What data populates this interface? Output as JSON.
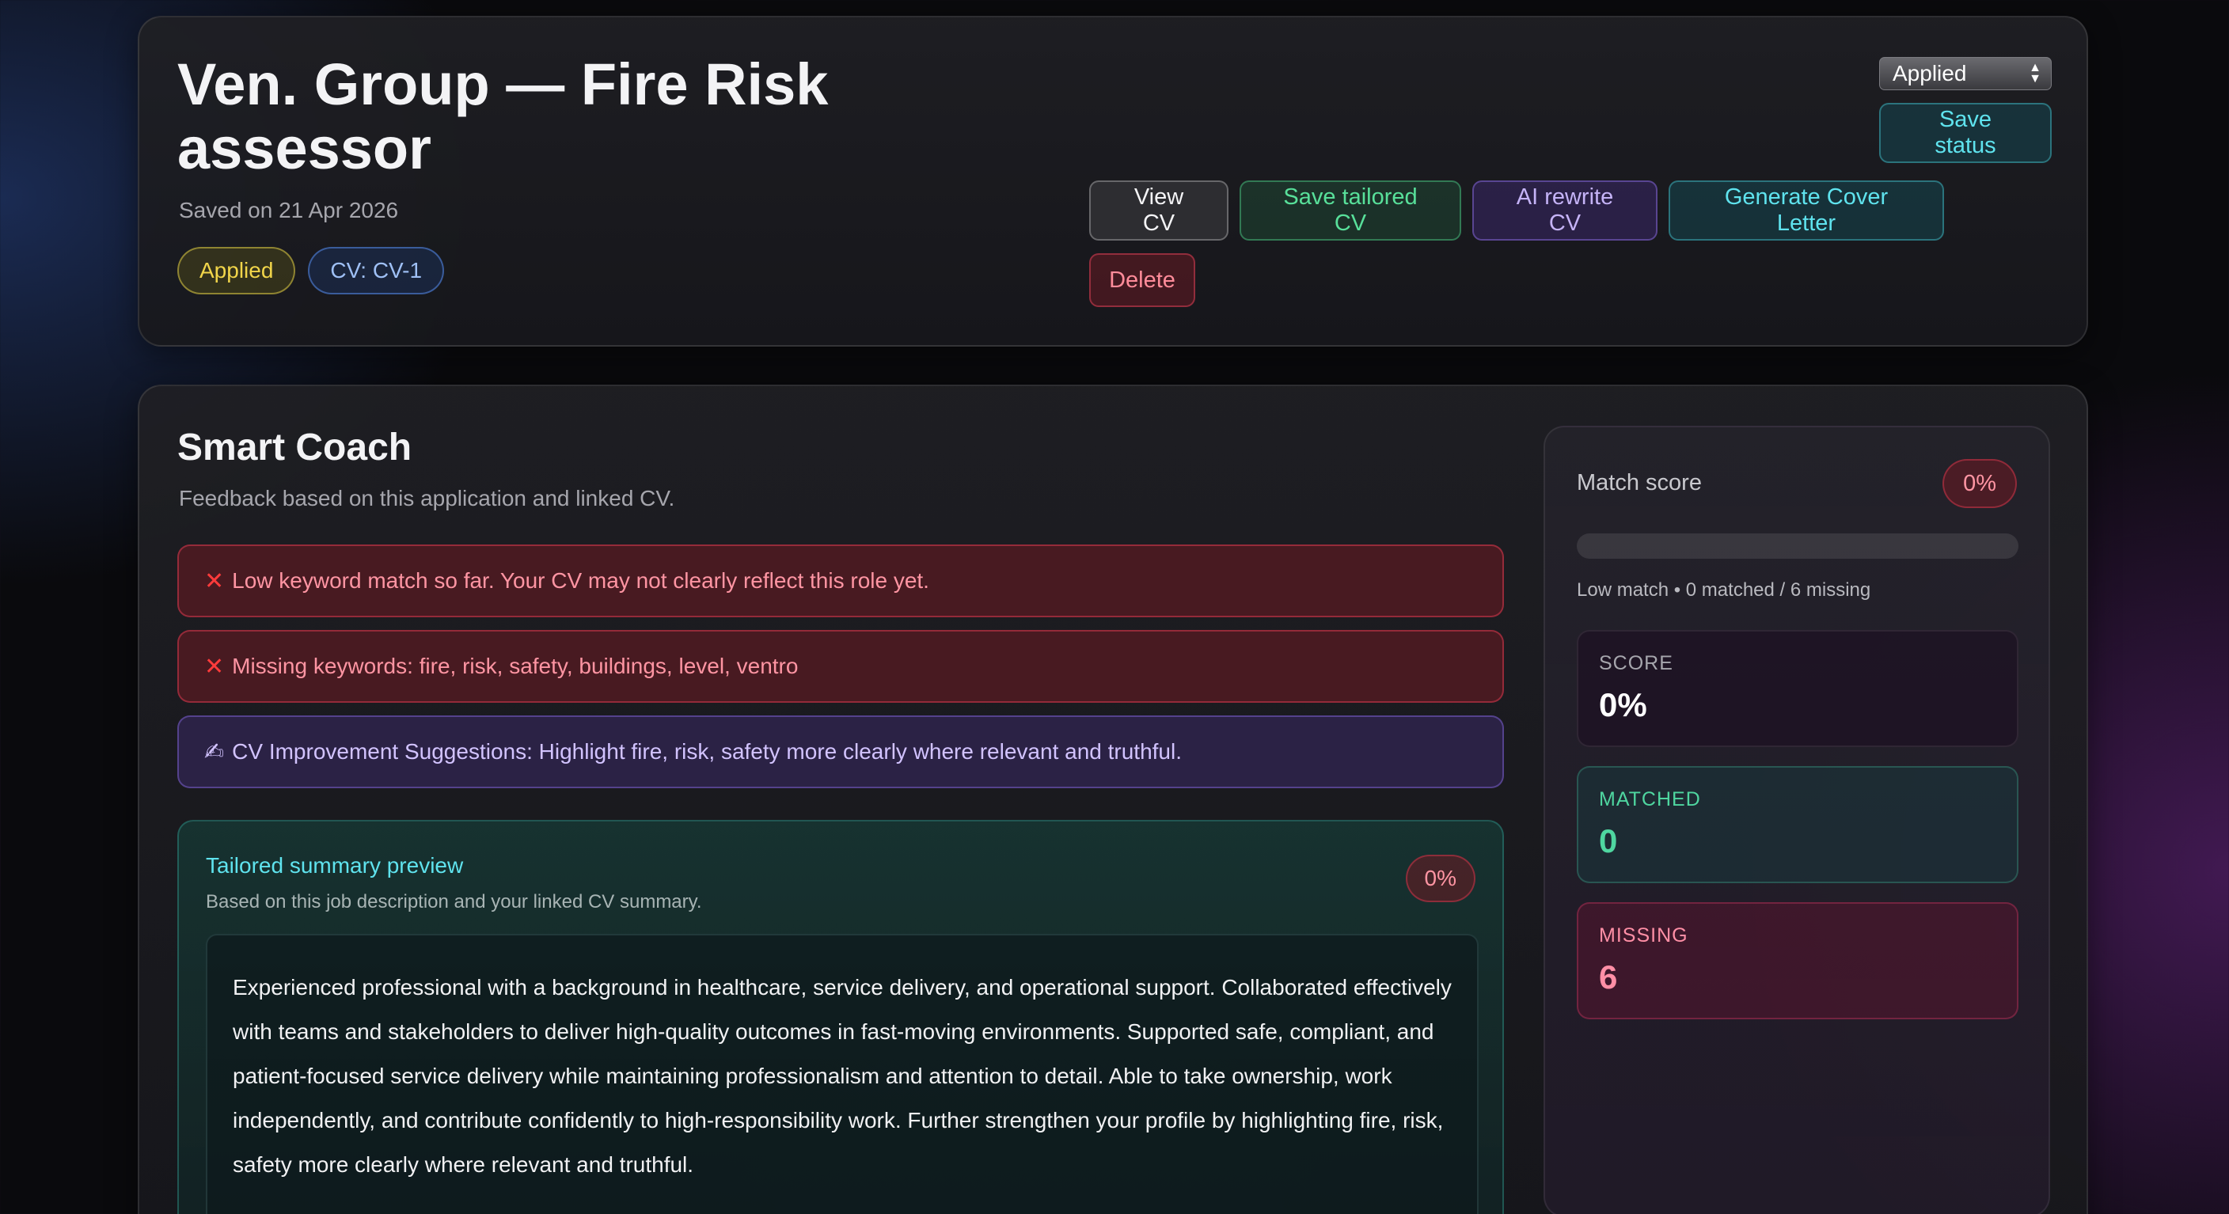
{
  "header": {
    "title": "Ven. Group — Fire Risk assessor",
    "saved": "Saved on 21 Apr 2026",
    "badges": {
      "status": "Applied",
      "cv": "CV: CV-1"
    },
    "actions": {
      "view_cv": "View CV",
      "save_tailored_cv": "Save tailored CV",
      "ai_rewrite_cv": "AI rewrite CV",
      "generate_cover_letter": "Generate Cover Letter",
      "delete": "Delete"
    },
    "status_select": {
      "selected": "Applied",
      "options": [
        "Applied"
      ]
    },
    "save_status": "Save status"
  },
  "coach": {
    "title": "Smart Coach",
    "subtitle": "Feedback based on this application and linked CV.",
    "alerts": [
      {
        "icon": "cross-icon",
        "text": "Low keyword match so far. Your CV may not clearly reflect this role yet."
      },
      {
        "icon": "cross-icon",
        "text": "Missing keywords: fire, risk, safety, buildings, level, ventro"
      },
      {
        "icon": "writing-hand-icon",
        "text": "CV Improvement Suggestions: Highlight fire, risk, safety more clearly where relevant and truthful."
      }
    ],
    "preview": {
      "title": "Tailored summary preview",
      "subtitle": "Based on this job description and your linked CV summary.",
      "badge": "0%",
      "body": "Experienced professional with a background in healthcare, service delivery, and operational support. Collaborated effectively with teams and stakeholders to deliver high-quality outcomes in fast-moving environments. Supported safe, compliant, and patient-focused service delivery while maintaining professionalism and attention to detail. Able to take ownership, work independently, and contribute confidently to high-responsibility work. Further strengthen your profile by highlighting fire, risk, safety more clearly where relevant and truthful."
    },
    "match": {
      "label": "Match score",
      "badge": "0%",
      "progress": 0,
      "meta": "Low match • 0 matched / 6 missing",
      "stats": {
        "score": {
          "label": "SCORE",
          "value": "0%"
        },
        "matched": {
          "label": "MATCHED",
          "value": "0"
        },
        "missing": {
          "label": "MISSING",
          "value": "6"
        }
      }
    }
  },
  "colors": {
    "accent_cyan": "#5fe3ee",
    "accent_green": "#58e09a",
    "accent_purple": "#c5b3f7",
    "danger": "#ff95a3",
    "warning": "#f1d54a"
  }
}
